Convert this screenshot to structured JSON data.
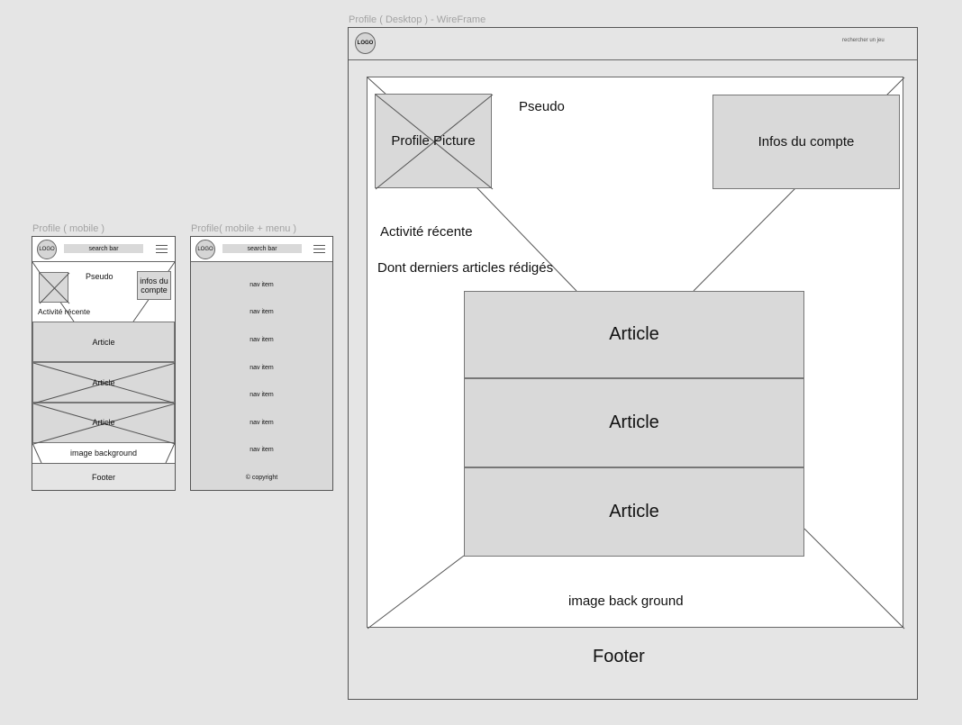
{
  "mobile": {
    "title": "Profile ( mobile )",
    "logo": "LOGO",
    "search": "search bar",
    "pseudo": "Pseudo",
    "infos": "infos du compte",
    "activity": "Activité récente",
    "articles": [
      "Article",
      "Article",
      "Article"
    ],
    "image_bg": "image background",
    "footer": "Footer"
  },
  "menu": {
    "title": "Profile( mobile + menu )",
    "logo": "LOGO",
    "search": "search bar",
    "nav_items": [
      "nav item",
      "nav item",
      "nav item",
      "nav item",
      "nav item",
      "nav item",
      "nav item"
    ],
    "copyright": "© copyright"
  },
  "desktop": {
    "title": "Profile ( Desktop ) - WireFrame",
    "logo": "LOGO",
    "search_placeholder": "rechercher un jeu",
    "profile_picture": "Profile Picture",
    "pseudo": "Pseudo",
    "infos": "Infos du compte",
    "activity": "Activité récente",
    "recent_articles": "Dont derniers articles rédigés",
    "articles": [
      "Article",
      "Article",
      "Article"
    ],
    "image_bg": "image back ground",
    "footer": "Footer"
  }
}
